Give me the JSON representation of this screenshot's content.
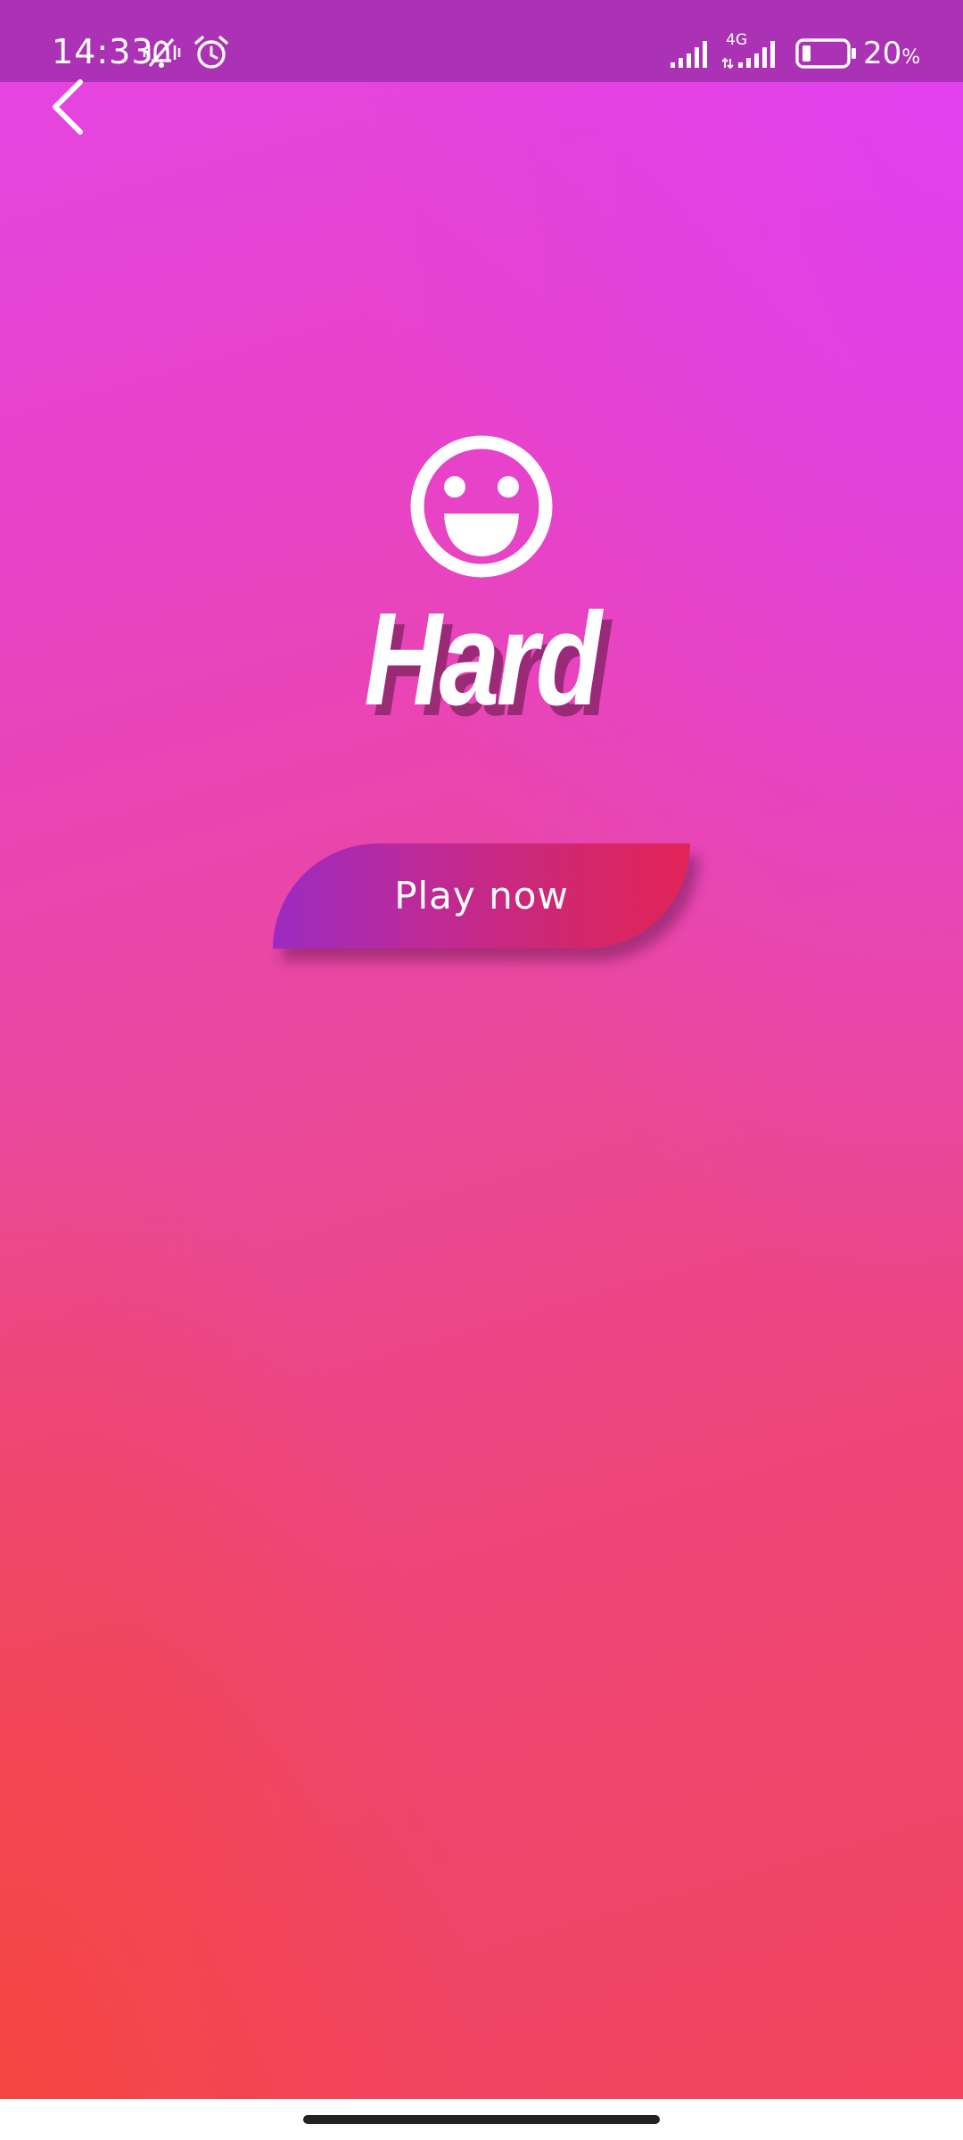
{
  "status_bar": {
    "time": "14:33",
    "network_label": "4G",
    "battery_percent": "20",
    "battery_unit": "%",
    "battery_level": 0.2,
    "icons": [
      "silent-mode-icon",
      "alarm-icon",
      "signal-icon",
      "signal-4g-icon",
      "battery-icon"
    ]
  },
  "header": {
    "back_icon": "chevron-left-icon"
  },
  "level": {
    "icon": "smiley-face-icon",
    "title": "Hard"
  },
  "play_button": {
    "label": "Play now"
  },
  "colors": {
    "status_bar": "#ab32b4",
    "gradient_top": "#e040f6",
    "gradient_bottom": "#f6463c",
    "button_start": "#9b2bc0",
    "button_end": "#e22357",
    "text": "#ffffff"
  }
}
